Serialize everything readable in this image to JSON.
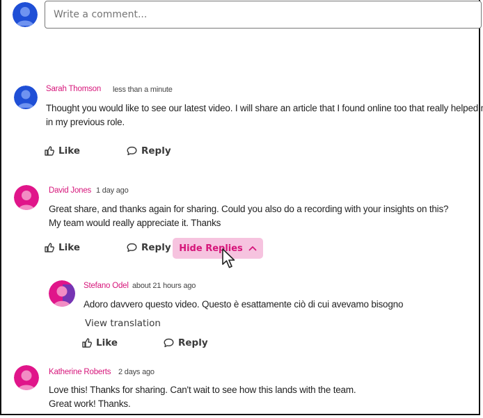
{
  "composer": {
    "placeholder": "Write a comment..."
  },
  "actions": {
    "like_label": "Like",
    "reply_label": "Reply",
    "hide_replies_label": "Hide Replies",
    "view_translation_label": "View translation"
  },
  "comments": [
    {
      "author": "Sarah Thomson",
      "time": "less than a minute",
      "lines": [
        "Thought you would like to see our latest video. I will share an article that I found online too that really helped me",
        "in my previous  role."
      ]
    },
    {
      "author": "David Jones",
      "time": "1 day ago",
      "lines": [
        "Great share, and thanks again for sharing. Could you also do a recording with your insights on this?",
        "My team would really appreciate it. Thanks"
      ],
      "replies": [
        {
          "author": "Stefano Odel",
          "time": "about 21 hours ago",
          "lines": [
            "Adoro davvero questo video. Questo è esattamente ciò di cui avevamo bisogno"
          ]
        }
      ]
    },
    {
      "author": "Katherine Roberts",
      "time": "2 days ago",
      "lines": [
        "Love this! Thanks for sharing. Can't wait to see how this lands with the team.",
        "Great work! Thanks."
      ]
    }
  ],
  "colors": {
    "accent": "#d6157a",
    "accent_soft": "#f6c3df",
    "avatar_blue": "#1f4fd6",
    "avatar_magenta": "#e0158a"
  }
}
